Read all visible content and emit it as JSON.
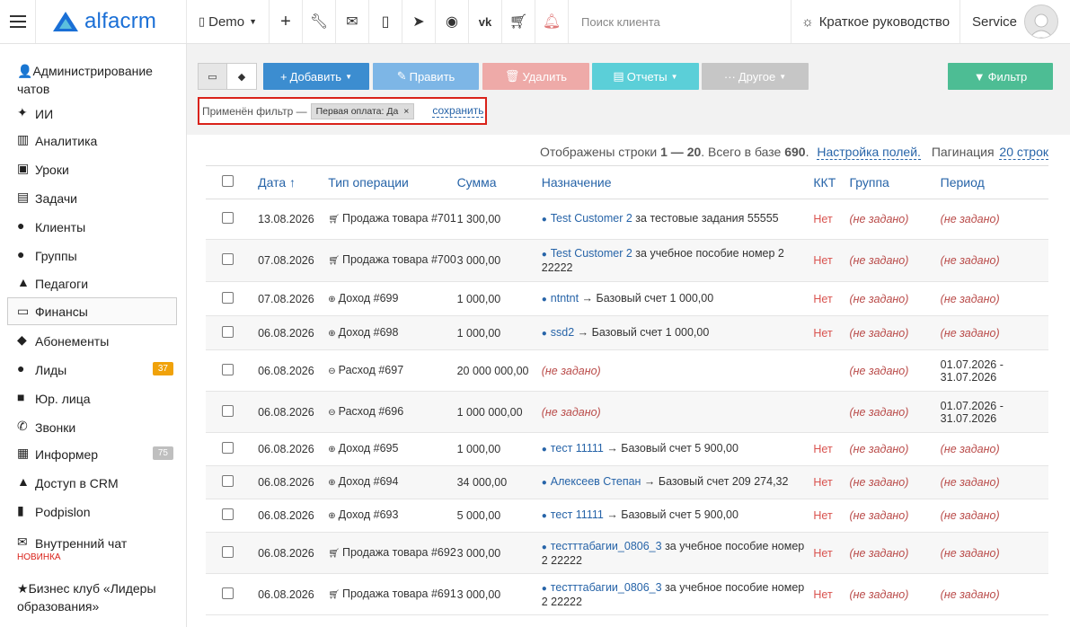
{
  "header": {
    "logo_text": "alfacrm",
    "demo_label": "Demo",
    "search_placeholder": "Поиск клиента",
    "guide_label": "Краткое руководство",
    "user_label": "Service"
  },
  "sidebar": {
    "items": [
      {
        "icon": "chat-admin-icon",
        "glyph": "👤",
        "label": "Администрирование чатов"
      },
      {
        "icon": "ai-sparkle-icon",
        "glyph": "✦",
        "label": "ИИ"
      },
      {
        "icon": "analytics-icon",
        "glyph": "▥",
        "label": "Аналитика"
      },
      {
        "icon": "calendar-icon",
        "glyph": "▣",
        "label": "Уроки"
      },
      {
        "icon": "tasks-icon",
        "glyph": "▤",
        "label": "Задачи"
      },
      {
        "icon": "user-icon",
        "glyph": "●",
        "label": "Клиенты"
      },
      {
        "icon": "users-icon",
        "glyph": "●",
        "label": "Группы"
      },
      {
        "icon": "graduation-cap-icon",
        "glyph": "▲",
        "label": "Педагоги"
      },
      {
        "icon": "money-icon",
        "glyph": "▭",
        "label": "Финансы"
      },
      {
        "icon": "tag-icon",
        "glyph": "◆",
        "label": "Абонементы"
      },
      {
        "icon": "user-plus-icon",
        "glyph": "●",
        "label": "Лиды",
        "badge": "37",
        "badge_color": "#f0a20a"
      },
      {
        "icon": "briefcase-icon",
        "glyph": "■",
        "label": "Юр. лица"
      },
      {
        "icon": "phone-icon",
        "glyph": "✆",
        "label": "Звонки"
      },
      {
        "icon": "newspaper-icon",
        "glyph": "▦",
        "label": "Информер",
        "badge": "75",
        "badge_color": "#bfbfbf"
      },
      {
        "icon": "lock-icon",
        "glyph": "▲",
        "label": "Доступ в CRM"
      },
      {
        "icon": "file-icon",
        "glyph": "▮",
        "label": "Podpislon"
      },
      {
        "icon": "envelope-icon",
        "glyph": "✉",
        "label": "Внутренний чат",
        "sub": "НОВИНКА"
      },
      {
        "icon": "star-icon",
        "glyph": "★",
        "label": "Бизнес клуб «Лидеры образования»"
      }
    ]
  },
  "toolbar": {
    "add_label": "Добавить",
    "edit_label": "Править",
    "delete_label": "Удалить",
    "reports_label": "Отчеты",
    "other_label": "Другое",
    "filter_label": "Фильтр",
    "colors": {
      "add": "#3c8dd0",
      "edit": "#7db6e6",
      "delete": "#eeaaa8",
      "reports": "#5bcfd8",
      "other": "#c6c6c6",
      "filter": "#4dbd94"
    }
  },
  "filter_bar": {
    "applied_text": "Применён фильтр —",
    "chip_label": "Первая оплата: Да",
    "chip_close": "×",
    "save_label": "сохранить"
  },
  "summary": {
    "pre": "Отображены строки ",
    "range": "1 — 20",
    "mid": ". Всего в базе ",
    "total": "690",
    "end": ".",
    "fields_link": "Настройка полей.",
    "pagination_text": "Пагинация",
    "pagination_link": "20 строк"
  },
  "table": {
    "columns": [
      "Дата ↑",
      "Тип операции",
      "Сумма",
      "Назначение",
      "ККТ",
      "Группа",
      "Период"
    ],
    "rows": [
      {
        "date": "13.08.2026",
        "op_icon": "cart-icon",
        "op": "Продажа товара #701",
        "sum": "1 300,00",
        "client": "Test Customer 2",
        "purpose": " за тестовые задания 55555",
        "kkt": "Нет",
        "group": "(не задано)",
        "period": "(не задано)"
      },
      {
        "date": "07.08.2026",
        "op_icon": "cart-icon",
        "op": "Продажа товара #700",
        "sum": "3 000,00",
        "client": "Test Customer 2",
        "purpose": " за учебное пособие номер 2 22222",
        "kkt": "Нет",
        "group": "(не задано)",
        "period": "(не задано)"
      },
      {
        "date": "07.08.2026",
        "op_icon": "income-icon",
        "op": "Доход #699",
        "sum": "1 000,00",
        "client": "ntntnt",
        "purpose": " → Базовый счет 1 000,00",
        "kkt": "Нет",
        "group": "(не задано)",
        "period": "(не задано)"
      },
      {
        "date": "06.08.2026",
        "op_icon": "income-icon",
        "op": "Доход #698",
        "sum": "1 000,00",
        "client": "ssd2",
        "purpose": " → Базовый счет 1 000,00",
        "kkt": "Нет",
        "group": "(не задано)",
        "period": "(не задано)"
      },
      {
        "date": "06.08.2026",
        "op_icon": "expense-icon",
        "op": "Расход #697",
        "sum": "20 000 000,00",
        "client": "",
        "purpose": "(не задано)",
        "kkt": "",
        "group": "(не задано)",
        "period": "01.07.2026 - 31.07.2026"
      },
      {
        "date": "06.08.2026",
        "op_icon": "expense-icon",
        "op": "Расход #696",
        "sum": "1 000 000,00",
        "client": "",
        "purpose": "(не задано)",
        "kkt": "",
        "group": "(не задано)",
        "period": "01.07.2026 - 31.07.2026"
      },
      {
        "date": "06.08.2026",
        "op_icon": "income-icon",
        "op": "Доход #695",
        "sum": "1 000,00",
        "client": "тест 11111",
        "purpose": " → Базовый счет 5 900,00",
        "kkt": "Нет",
        "group": "(не задано)",
        "period": "(не задано)"
      },
      {
        "date": "06.08.2026",
        "op_icon": "income-icon",
        "op": "Доход #694",
        "sum": "34 000,00",
        "client": "Алексеев Степан",
        "purpose": " → Базовый счет 209 274,32",
        "kkt": "Нет",
        "group": "(не задано)",
        "period": "(не задано)"
      },
      {
        "date": "06.08.2026",
        "op_icon": "income-icon",
        "op": "Доход #693",
        "sum": "5 000,00",
        "client": "тест 11111",
        "purpose": " → Базовый счет 5 900,00",
        "kkt": "Нет",
        "group": "(не задано)",
        "period": "(не задано)"
      },
      {
        "date": "06.08.2026",
        "op_icon": "cart-icon",
        "op": "Продажа товара #692",
        "sum": "3 000,00",
        "client": "тестттабагии_0806_3",
        "purpose": " за учебное пособие номер 2 22222",
        "kkt": "Нет",
        "group": "(не задано)",
        "period": "(не задано)"
      },
      {
        "date": "06.08.2026",
        "op_icon": "cart-icon",
        "op": "Продажа товара #691",
        "sum": "3 000,00",
        "client": "тестттабагии_0806_3",
        "purpose": " за учебное пособие номер 2 22222",
        "kkt": "Нет",
        "group": "(не задано)",
        "period": "(не задано)"
      }
    ]
  }
}
